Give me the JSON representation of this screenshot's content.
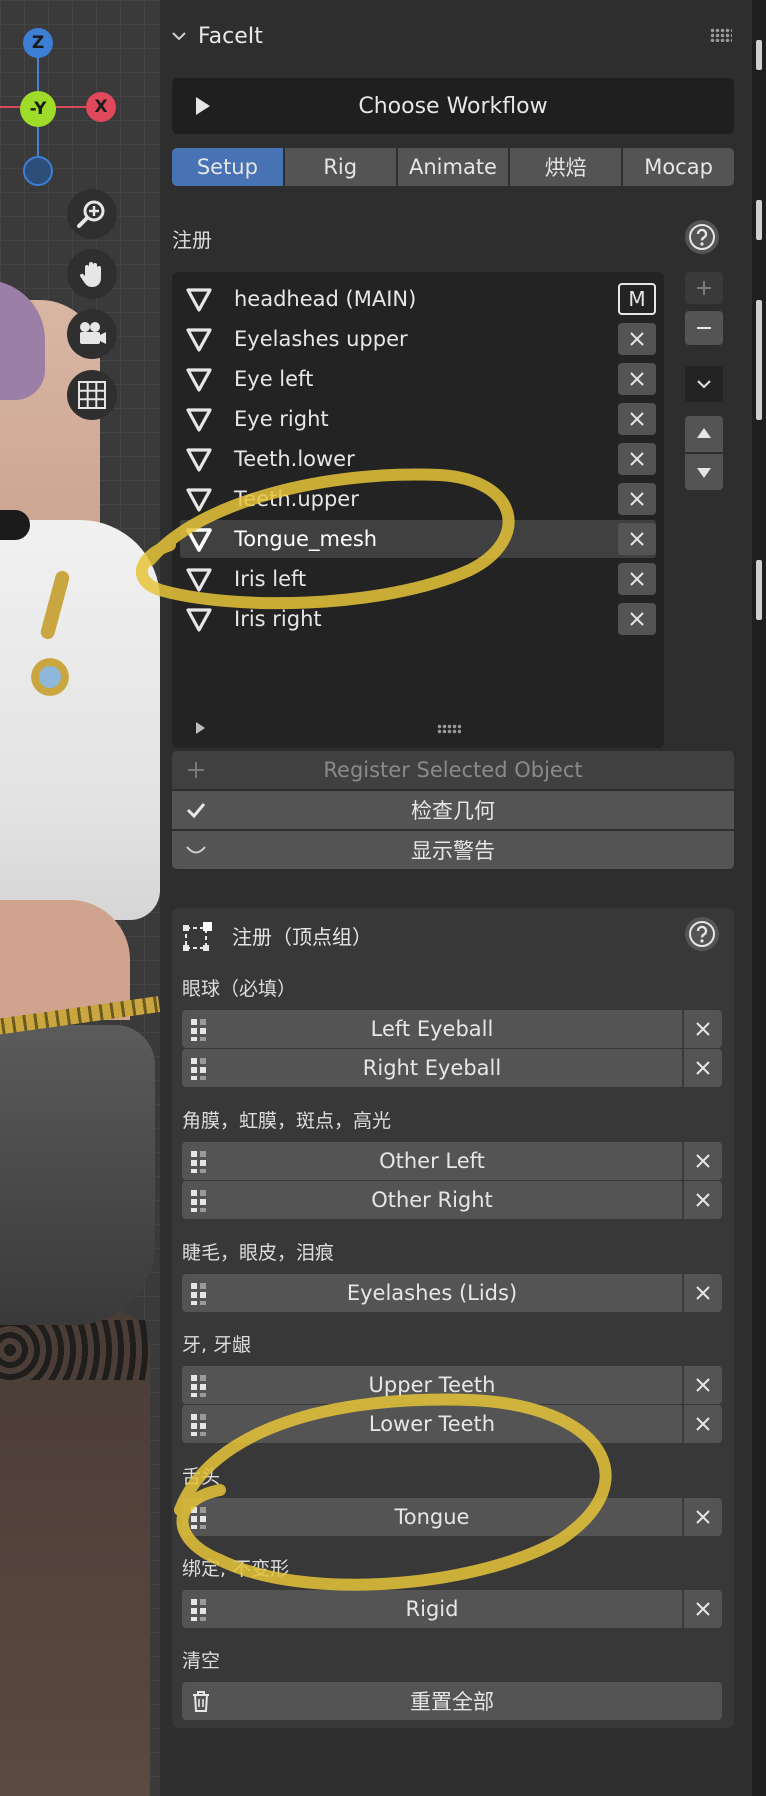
{
  "gizmo": {
    "z": "Z",
    "y": "-Y",
    "x": "X"
  },
  "panel": {
    "title": "FaceIt"
  },
  "workflow": {
    "label": "Choose Workflow"
  },
  "tabs": [
    {
      "label": "Setup",
      "active": true
    },
    {
      "label": "Rig",
      "active": false
    },
    {
      "label": "Animate",
      "active": false
    },
    {
      "label": "烘焙",
      "active": false
    },
    {
      "label": "Mocap",
      "active": false
    }
  ],
  "register": {
    "heading": "注册",
    "objects": [
      {
        "label": "headhead (MAIN)",
        "badge": "M"
      },
      {
        "label": "Eyelashes upper"
      },
      {
        "label": "Eye left"
      },
      {
        "label": "Eye right"
      },
      {
        "label": "Teeth.lower"
      },
      {
        "label": "Teeth.upper"
      },
      {
        "label": "Tongue_mesh",
        "selected": true
      },
      {
        "label": "Iris left"
      },
      {
        "label": "Iris right"
      }
    ],
    "register_selected": "Register Selected Object",
    "check_geometry": "检查几何",
    "show_warnings": "显示警告"
  },
  "vertex_groups": {
    "title": "注册（顶点组）",
    "groups": [
      {
        "label": "眼球（必填）",
        "items": [
          "Left Eyeball",
          "Right Eyeball"
        ]
      },
      {
        "label": "角膜，虹膜，斑点，高光",
        "items": [
          "Other Left",
          "Other Right"
        ]
      },
      {
        "label": "睫毛，眼皮，泪痕",
        "items": [
          "Eyelashes (Lids)"
        ]
      },
      {
        "label": "牙, 牙龈",
        "items": [
          "Upper Teeth",
          "Lower Teeth"
        ]
      },
      {
        "label": "舌头",
        "items": [
          "Tongue"
        ]
      },
      {
        "label": "绑定, 不变形",
        "items": [
          "Rigid"
        ]
      },
      {
        "label": "清空",
        "items": [
          "重置全部"
        ]
      }
    ]
  },
  "colors": {
    "accent": "#4772b3",
    "annotation": "#e6c43a"
  }
}
